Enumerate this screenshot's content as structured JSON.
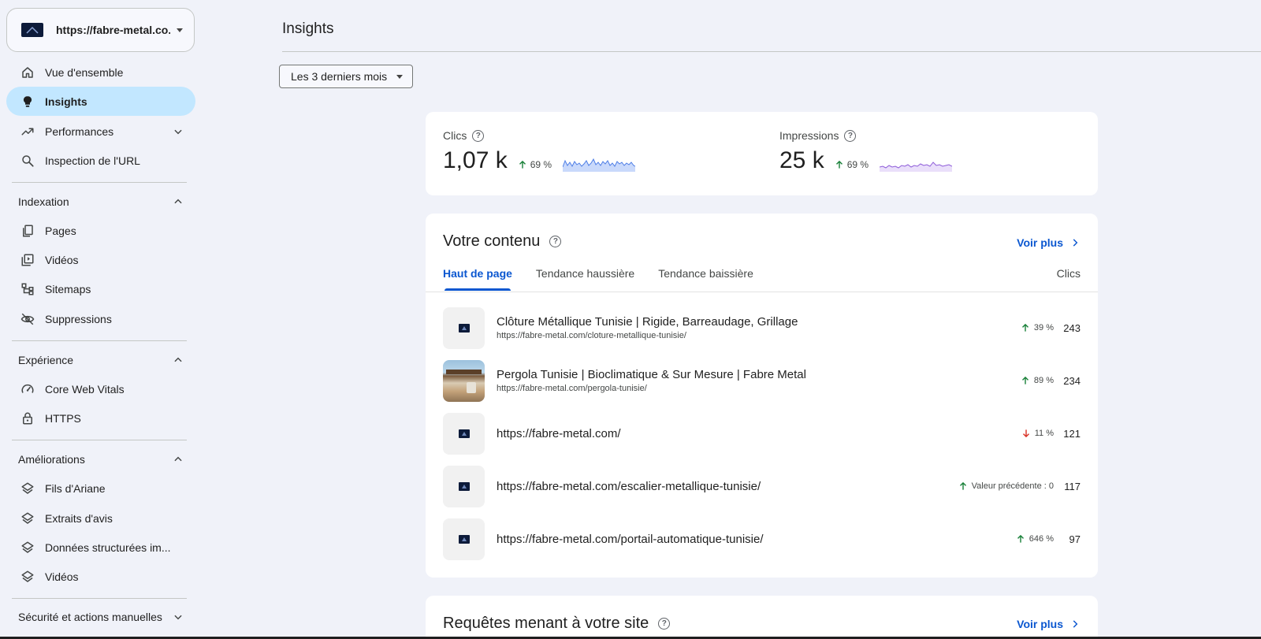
{
  "sidebar": {
    "property": {
      "label": "https://fabre-metal.co..."
    },
    "items": [
      {
        "label": "Vue d'ensemble",
        "icon": "home-icon"
      },
      {
        "label": "Insights",
        "icon": "lightbulb-icon",
        "active": true
      },
      {
        "label": "Performances",
        "icon": "trending-up-icon"
      },
      {
        "label": "Inspection de l'URL",
        "icon": "search-icon"
      }
    ],
    "sections": [
      {
        "label": "Indexation",
        "items": [
          {
            "label": "Pages",
            "icon": "pages-icon"
          },
          {
            "label": "Vidéos",
            "icon": "video-icon"
          },
          {
            "label": "Sitemaps",
            "icon": "sitemap-icon"
          },
          {
            "label": "Suppressions",
            "icon": "visibility-off-icon"
          }
        ]
      },
      {
        "label": "Expérience",
        "items": [
          {
            "label": "Core Web Vitals",
            "icon": "speed-icon"
          },
          {
            "label": "HTTPS",
            "icon": "lock-icon"
          }
        ]
      },
      {
        "label": "Améliorations",
        "items": [
          {
            "label": "Fils d'Ariane",
            "icon": "layers-icon"
          },
          {
            "label": "Extraits d'avis",
            "icon": "layers-icon"
          },
          {
            "label": "Données structurées im...",
            "icon": "layers-icon"
          },
          {
            "label": "Vidéos",
            "icon": "layers-icon"
          }
        ]
      },
      {
        "label": "Sécurité et actions manuelles"
      }
    ]
  },
  "main": {
    "title": "Insights",
    "period": "Les 3 derniers mois",
    "metrics": [
      {
        "label": "Clics",
        "value": "1,07 k",
        "trend": "69 %",
        "trend_dir": "up",
        "spark_color": "#4e7ee6",
        "spark_fill": "#c9d9fb"
      },
      {
        "label": "Impressions",
        "value": "25 k",
        "trend": "69 %",
        "trend_dir": "up",
        "spark_color": "#8e5cd9",
        "spark_fill": "#eadffa"
      }
    ],
    "content": {
      "title": "Votre contenu",
      "see_more": "Voir plus",
      "tabs": [
        "Haut de page",
        "Tendance haussière",
        "Tendance baissière"
      ],
      "clicks_header": "Clics",
      "rows": [
        {
          "title": "Clôture Métallique Tunisie | Rigide, Barreaudage, Grillage",
          "url": "https://fabre-metal.com/cloture-metallique-tunisie/",
          "change": "39 %",
          "dir": "up",
          "clicks": "243",
          "thumb": "logo"
        },
        {
          "title": "Pergola Tunisie | Bioclimatique & Sur Mesure | Fabre Metal",
          "url": "https://fabre-metal.com/pergola-tunisie/",
          "change": "89 %",
          "dir": "up",
          "clicks": "234",
          "thumb": "photo"
        },
        {
          "title": "https://fabre-metal.com/",
          "url": "",
          "change": "11 %",
          "dir": "down",
          "clicks": "121",
          "thumb": "logo"
        },
        {
          "title": "https://fabre-metal.com/escalier-metallique-tunisie/",
          "url": "",
          "change": "Valeur précédente : 0",
          "dir": "up",
          "clicks": "117",
          "thumb": "logo"
        },
        {
          "title": "https://fabre-metal.com/portail-automatique-tunisie/",
          "url": "",
          "change": "646 %",
          "dir": "up",
          "clicks": "97",
          "thumb": "logo"
        }
      ]
    },
    "queries": {
      "title": "Requêtes menant à votre site",
      "see_more": "Voir plus"
    }
  },
  "colors": {
    "accent": "#0b57d0",
    "active_nav": "#c2e7ff",
    "trend_up": "#188038",
    "trend_down": "#d93025"
  }
}
